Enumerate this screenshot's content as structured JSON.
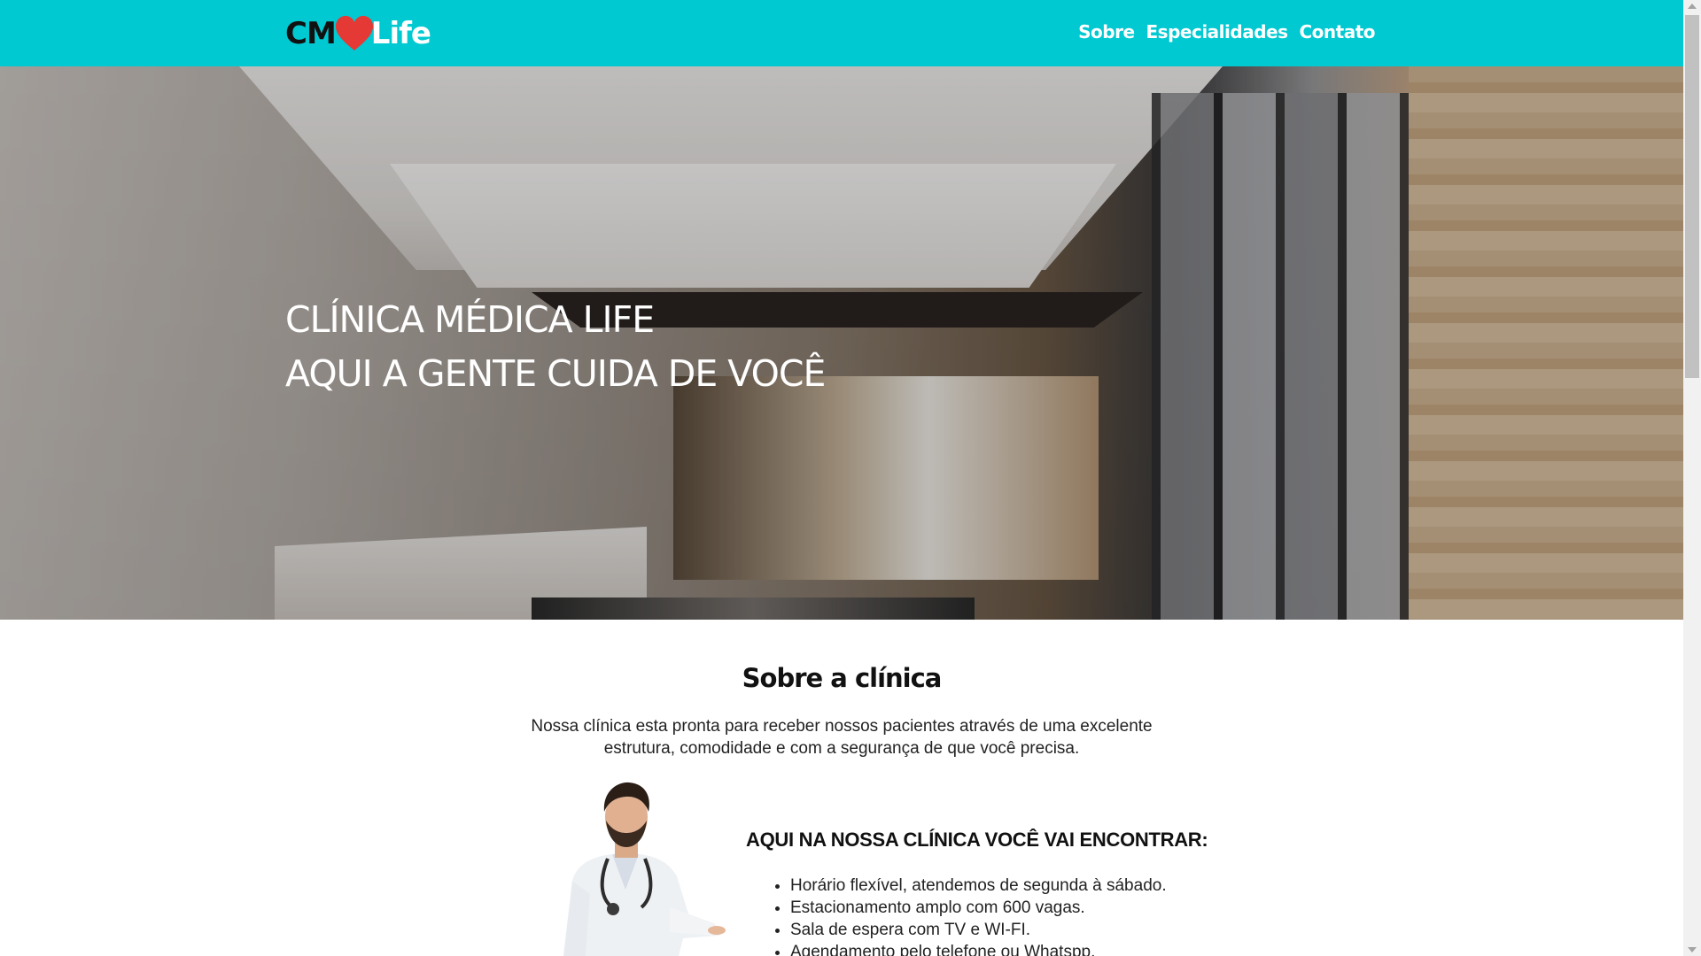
{
  "header": {
    "logo": {
      "left": "CM",
      "right": "Life",
      "heart_icon": "heart-icon"
    },
    "nav": [
      {
        "label": "Sobre"
      },
      {
        "label": "Especialidades"
      },
      {
        "label": "Contato"
      }
    ],
    "colors": {
      "bar": "#00c9d1",
      "heart": "#e53935",
      "nav_text": "#ffffff"
    }
  },
  "hero": {
    "line1": "CLÍNICA MÉDICA LIFE",
    "line2": "AQUI A GENTE CUIDA DE VOCÊ"
  },
  "about": {
    "title": "Sobre a clínica",
    "text": "Nossa clínica esta pronta para receber nossos pacientes através de uma excelente estrutura, comodidade e com a segurança de que você precisa.",
    "features_title": "AQUI NA NOSSA CLÍNICA VOCÊ VAI ENCONTRAR:",
    "features": [
      "Horário flexível, atendemos de segunda à sábado.",
      "Estacionamento amplo com 600 vagas.",
      "Sala de espera com TV e WI-FI.",
      "Agendamento pelo telefone ou Whatspp."
    ]
  }
}
